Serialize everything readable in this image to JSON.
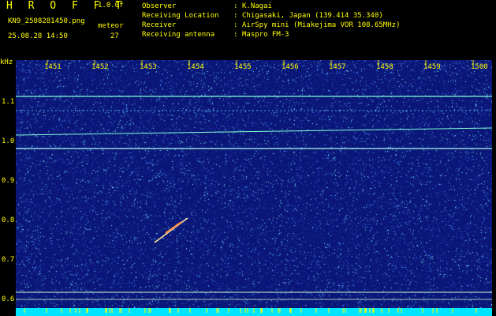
{
  "header": {
    "app_title": "H R O F F T",
    "version": "1.0.0f",
    "filename": "KN9_2508281450.png",
    "mode": "meteor",
    "datetime": "25.08.28 14:50",
    "count": "27"
  },
  "meta": [
    {
      "key": "Observer",
      "sep": ":",
      "value": "K.Nagai"
    },
    {
      "key": "Receiving Location",
      "sep": ":",
      "value": "Chigasaki, Japan (139.414 35.340)"
    },
    {
      "key": "Receiver",
      "sep": ":",
      "value": "AirSpy mini (Miakejima VOR 108.65MHz)"
    },
    {
      "key": "Receiving antenna",
      "sep": ":",
      "value": "Maspro FM-3"
    }
  ],
  "axis": {
    "unit": "kHz",
    "y_ticks": [
      "1.1",
      "1.0",
      "0.9",
      "0.8",
      "0.7",
      "0.6"
    ],
    "time_ticks": [
      "1451",
      "1452",
      "1453",
      "1454",
      "1455",
      "1456",
      "1457",
      "1458",
      "1459",
      "1500"
    ]
  },
  "colors": {
    "text": "#ffff00",
    "background": "#000000",
    "plot_background": "#0b1778",
    "noise": "#3a7bff",
    "carrier": "#7fffd4",
    "bottom_strip": "#00e5ff"
  }
}
